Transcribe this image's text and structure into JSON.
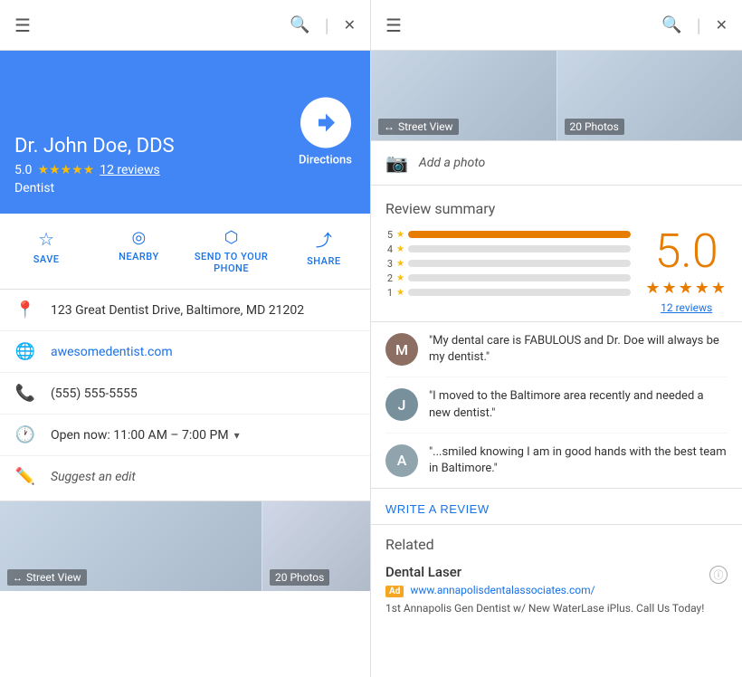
{
  "left": {
    "header": {
      "menu_label": "☰",
      "search_label": "🔍",
      "close_label": "✕"
    },
    "place": {
      "name": "Dr. John Doe, DDS",
      "rating": "5.0",
      "stars": "★★★★★",
      "reviews": "12 reviews",
      "type": "Dentist",
      "directions_label": "Directions"
    },
    "actions": [
      {
        "id": "save",
        "icon": "★",
        "label": "SAVE"
      },
      {
        "id": "nearby",
        "icon": "⊙",
        "label": "NEARBY"
      },
      {
        "id": "send",
        "icon": "↵",
        "label": "SEND TO YOUR\nPHONE"
      },
      {
        "id": "share",
        "icon": "⤴",
        "label": "SHARE"
      }
    ],
    "info": {
      "address": "123 Great Dentist Drive, Baltimore, MD 21202",
      "website": "awesomedentist.com",
      "phone": "(555) 555-5555",
      "hours": "Open now:  11:00 AM – 7:00 PM",
      "suggest": "Suggest an edit"
    },
    "street_view_label": "Street View",
    "photos_label": "20 Photos"
  },
  "right": {
    "header": {
      "menu_label": "☰",
      "search_label": "🔍",
      "close_label": "✕"
    },
    "street_view_label": "Street View",
    "photos_label": "20 Photos",
    "add_photo": "Add a photo",
    "review_summary": {
      "title": "Review summary",
      "big_rating": "5.0",
      "big_stars": "★★★★★",
      "total_reviews": "12 reviews",
      "bars": [
        {
          "num": "5",
          "pct": 100
        },
        {
          "num": "4",
          "pct": 0
        },
        {
          "num": "3",
          "pct": 0
        },
        {
          "num": "2",
          "pct": 0
        },
        {
          "num": "1",
          "pct": 0
        }
      ]
    },
    "reviews": [
      {
        "id": "r1",
        "avatar_color": "#8d6e63",
        "avatar_text": "M",
        "text": "\"My dental care is FABULOUS and Dr. Doe will always be my dentist.\""
      },
      {
        "id": "r2",
        "avatar_color": "#78909c",
        "avatar_text": "J",
        "text": "\"I moved to the Baltimore area recently and needed a new dentist.\""
      },
      {
        "id": "r3",
        "avatar_color": "#90a4ae",
        "avatar_text": "A",
        "text": "\"...smiled knowing I am in good hands with the best team in Baltimore.\""
      }
    ],
    "write_review": "WRITE A REVIEW",
    "related": {
      "title": "Related",
      "item_name": "Dental Laser",
      "item_ad": "Ad",
      "item_url": "www.annapolisdentalassociates.com/",
      "item_desc": "1st Annapolis Gen Dentist w/ New WaterLase iPlus. Call Us Today!"
    }
  }
}
